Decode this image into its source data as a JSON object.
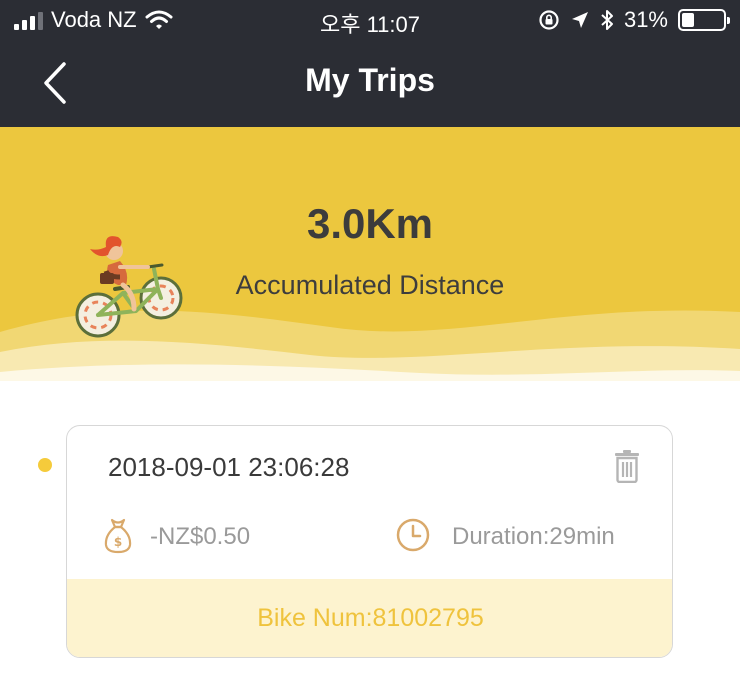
{
  "status_bar": {
    "carrier": "Voda NZ",
    "time": "오후 11:07",
    "battery_percent": "31%",
    "battery_level": 0.31
  },
  "nav": {
    "title": "My Trips",
    "back_icon": "chevron-left-icon"
  },
  "summary": {
    "distance": "3.0Km",
    "distance_label": "Accumulated Distance",
    "accent_color": "#ecc73e"
  },
  "trips": [
    {
      "datetime": "2018-09-01 23:06:28",
      "cost": "-NZ$0.50",
      "duration": "Duration:29min",
      "bike_num": "Bike Num:81002795"
    }
  ]
}
